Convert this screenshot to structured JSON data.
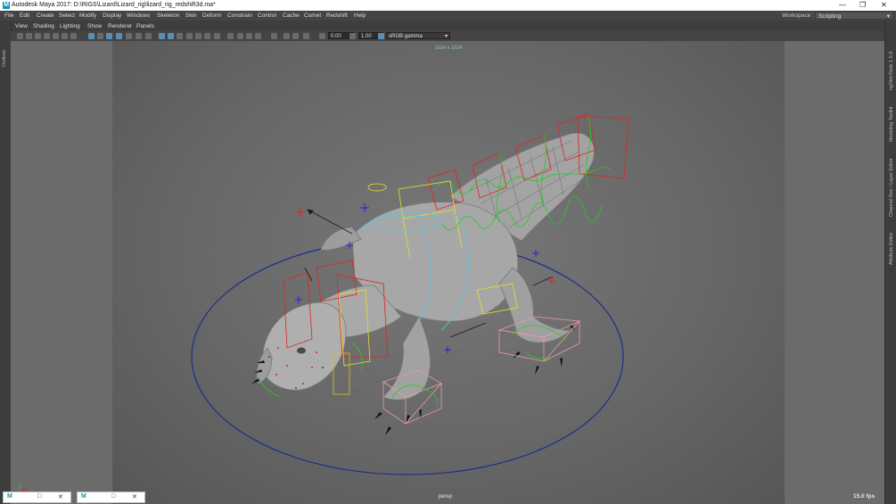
{
  "window": {
    "title": "Autodesk Maya 2017: D:\\RIGS\\Lizard\\Lizard_rig\\lizard_rig_redshift3d.ma*",
    "logo_letter": "M",
    "controls": [
      "—",
      "❐",
      "✕"
    ]
  },
  "menubar": {
    "items": [
      "File",
      "Edit",
      "Create",
      "Select",
      "Modify",
      "Display",
      "Windows",
      "Skeleton",
      "Skin",
      "Deform",
      "Constrain",
      "Control",
      "Cache",
      "Comet",
      "Redshift",
      "Help"
    ],
    "workspace_label": "Workspace :",
    "workspace_value": "Scripting"
  },
  "left_strip": {
    "label": "Outliner"
  },
  "right_strip": {
    "labels": [
      "ngSkinTools 1.5.9",
      "Modeling Toolkit",
      "Channel Box / Layer Editor",
      "Attribute Editor"
    ]
  },
  "panel_menu": {
    "items": [
      "View",
      "Shading",
      "Lighting",
      "Show",
      "Renderer",
      "Panels"
    ]
  },
  "toolbar": {
    "exposure_value": "0.00",
    "gamma_value": "1.00",
    "colorspace_value": "sRGB gamma"
  },
  "viewport": {
    "resolution_label": "1024 x 1024",
    "camera_label": "persp",
    "fps_label": "15.0 fps"
  },
  "taskbar": {
    "icons": [
      "M",
      "M"
    ]
  },
  "colors": {
    "viewport_bg": "#6b6b6b",
    "gate_bg": "#767676",
    "ground_circle": "#1e2e8c",
    "control_red": "#e02424",
    "control_yellow": "#e8e020",
    "control_green": "#22cc22",
    "control_cyan": "#58c8e0",
    "control_pink": "#e89aa8"
  }
}
